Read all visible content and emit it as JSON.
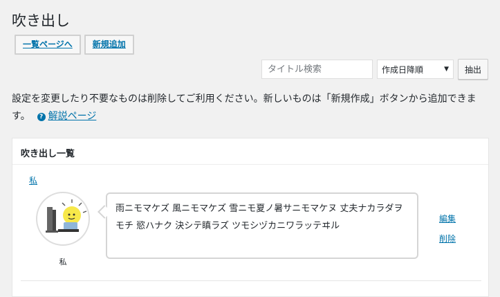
{
  "page": {
    "title": "吹き出し"
  },
  "top_buttons": {
    "list_page": "一覧ページへ",
    "add_new": "新規追加"
  },
  "filter": {
    "search_placeholder": "タイトル検索",
    "sort_selected": "作成日降順",
    "extract_label": "抽出"
  },
  "description": {
    "text": "設定を変更したり不要なものは削除してご利用ください。新しいものは「新規作成」ボタンから追加できます。",
    "help_link": "解説ページ"
  },
  "panel": {
    "title": "吹き出し一覧",
    "items": [
      {
        "name": "私",
        "avatar_caption": "私",
        "text": "雨ニモマケズ 風ニモマケズ 雪ニモ夏ノ暑サニモマケヌ 丈夫ナカラダヲモチ 慾ハナク 決シテ瞋ラズ ツモシヅカニワラッテヰル",
        "edit_label": "編集",
        "delete_label": "削除"
      }
    ]
  },
  "colors": {
    "link": "#0073aa",
    "background": "#f1f1f1",
    "panel": "#ffffff"
  }
}
